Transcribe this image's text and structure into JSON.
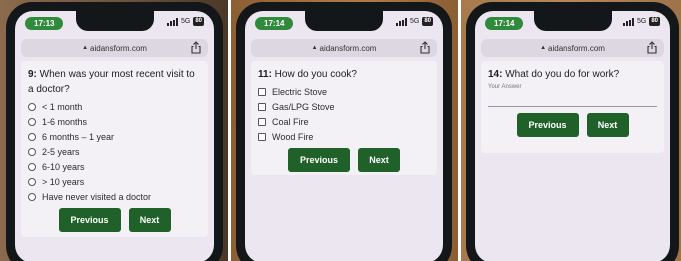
{
  "common": {
    "url": "aidansform.com",
    "network": "5G",
    "previous_label": "Previous",
    "next_label": "Next"
  },
  "phones": [
    {
      "time": "17:13",
      "battery": "80",
      "question_number": "9:",
      "question_text": " When was your most recent visit to a doctor?",
      "input_type": "radio",
      "options": [
        "< 1 month",
        "1-6 months",
        "6 months – 1 year",
        "2-5 years",
        "6-10 years",
        "> 10 years",
        "Have never visited a doctor"
      ]
    },
    {
      "time": "17:14",
      "battery": "80",
      "question_number": "11:",
      "question_text": " How do you cook?",
      "input_type": "checkbox",
      "options": [
        "Electric Stove",
        "Gas/LPG Stove",
        "Coal Fire",
        "Wood Fire"
      ]
    },
    {
      "time": "17:14",
      "battery": "80",
      "question_number": "14:",
      "question_text": " What do you do for work?",
      "input_type": "text",
      "answer_placeholder": "Your Answer"
    }
  ]
}
